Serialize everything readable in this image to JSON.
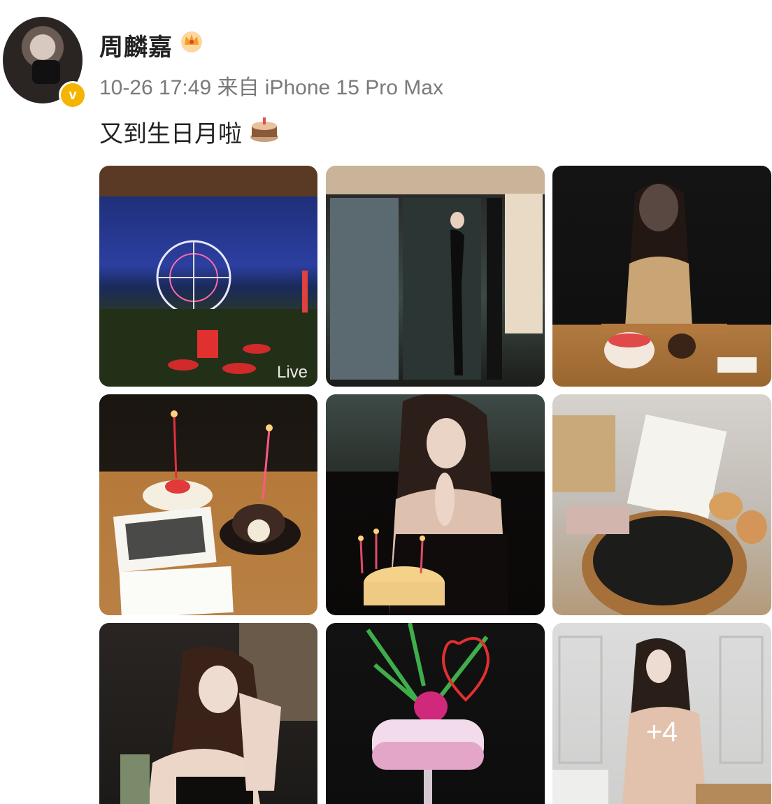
{
  "user": {
    "name": "周麟嘉",
    "avatar_icon": "avatar-image",
    "verified_icon": "verified-v-icon",
    "badge_icon": "crown-icon"
  },
  "post": {
    "meta": "10-26 17:49 来自 iPhone 15 Pro Max",
    "text": "又到生日月啦",
    "emoji_icon": "cake-icon"
  },
  "photos": [
    {
      "name": "ferris-wheel-night",
      "badge": "Live"
    },
    {
      "name": "black-dress-doorway"
    },
    {
      "name": "praying-gold-dress"
    },
    {
      "name": "cakes-and-card"
    },
    {
      "name": "candles-wish"
    },
    {
      "name": "note-and-pastry"
    },
    {
      "name": "portrait-hand-cheek"
    },
    {
      "name": "love-cocktail"
    },
    {
      "name": "white-room-portrait",
      "more": "+4"
    }
  ],
  "colors": {
    "meta_gray": "#7a7a7a",
    "text_dark": "#222222",
    "verified_yellow": "#f5b400"
  }
}
